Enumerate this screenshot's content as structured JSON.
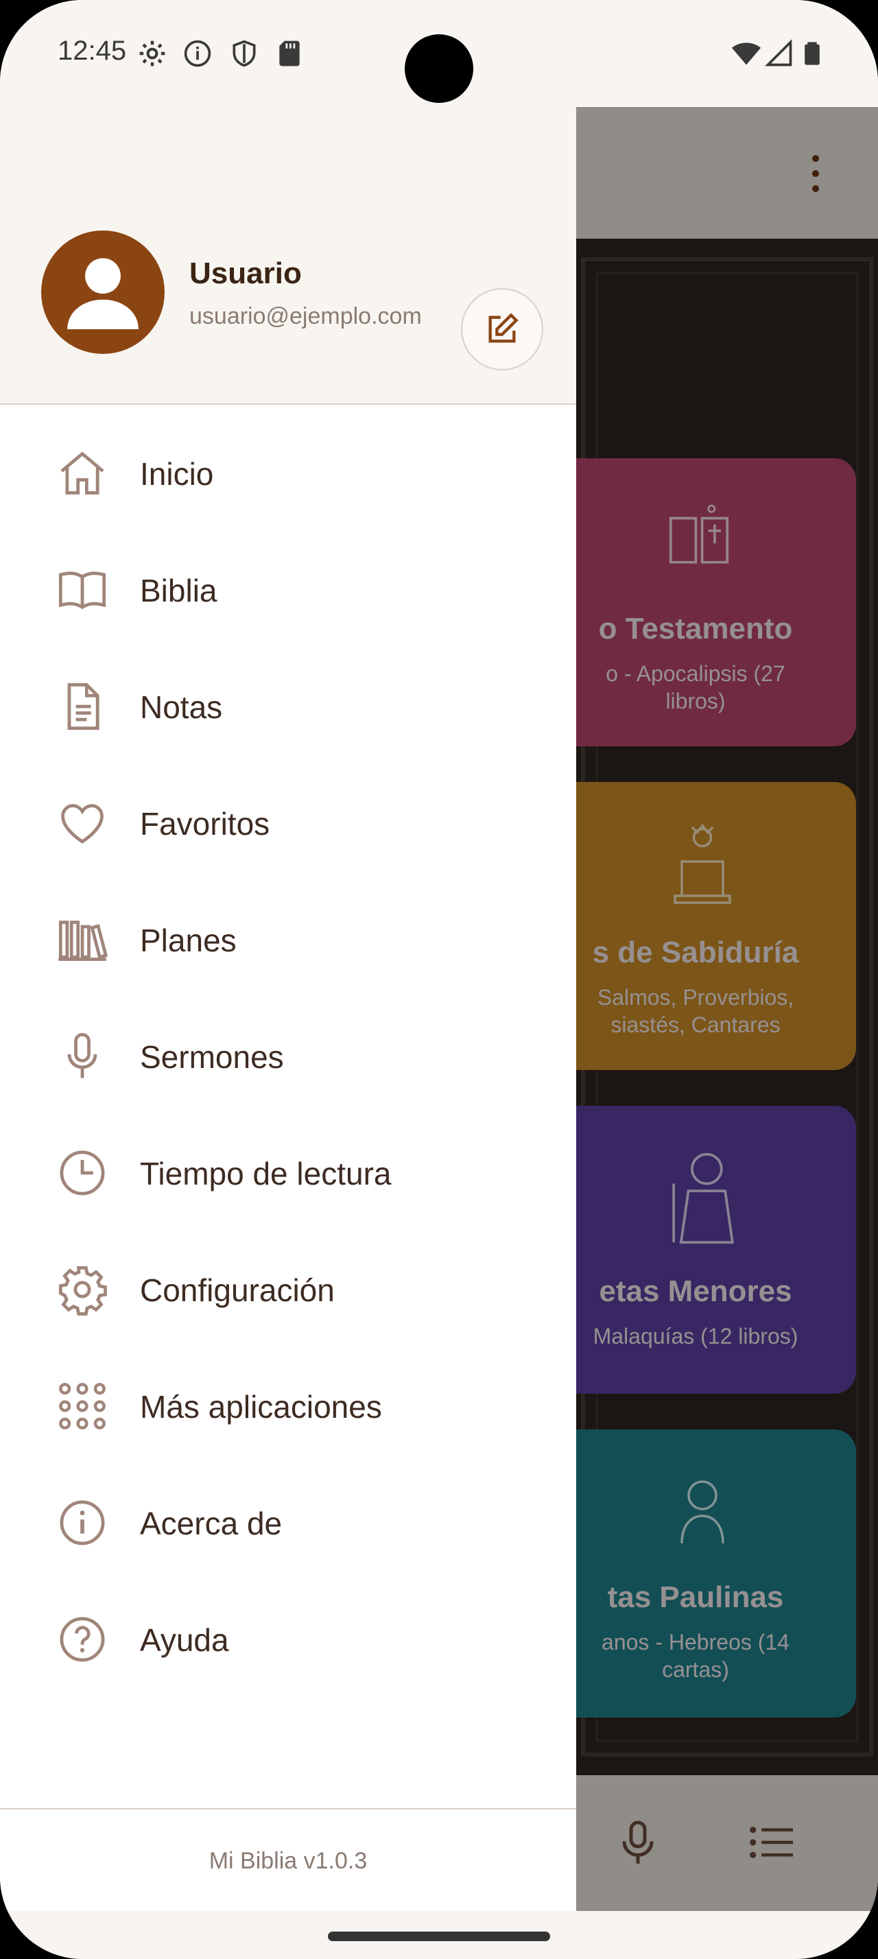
{
  "status_bar": {
    "time": "12:45",
    "left_icons": [
      "settings-icon",
      "info-icon",
      "shield-icon",
      "sd-card-icon"
    ],
    "right_icons": [
      "wifi-icon",
      "signal-icon",
      "battery-icon"
    ]
  },
  "drawer": {
    "user": {
      "name": "Usuario",
      "email": "usuario@ejemplo.com"
    },
    "menu": [
      {
        "label": "Inicio",
        "icon": "home-icon"
      },
      {
        "label": "Biblia",
        "icon": "book-open-icon"
      },
      {
        "label": "Notas",
        "icon": "document-icon"
      },
      {
        "label": "Favoritos",
        "icon": "heart-icon"
      },
      {
        "label": "Planes",
        "icon": "library-icon"
      },
      {
        "label": "Sermones",
        "icon": "microphone-icon"
      },
      {
        "label": "Tiempo de lectura",
        "icon": "clock-icon"
      },
      {
        "label": "Configuración",
        "icon": "gear-icon"
      },
      {
        "label": "Más aplicaciones",
        "icon": "grid-dots-icon"
      },
      {
        "label": "Acerca de",
        "icon": "info-icon"
      },
      {
        "label": "Ayuda",
        "icon": "help-icon"
      }
    ],
    "version": "Mi Biblia v1.0.3"
  },
  "background": {
    "cards": [
      {
        "title": "o Testamento",
        "subtitle": [
          "o - Apocalipsis (27",
          "libros)"
        ],
        "color": "#b5456e"
      },
      {
        "title": "s de Sabiduría",
        "subtitle": [
          "Salmos, Proverbios,",
          "siastés, Cantares"
        ],
        "color": "#c98a28"
      },
      {
        "title": "etas Menores",
        "subtitle": [
          "Malaquías (12 libros)"
        ],
        "color": "#5b3f9e"
      },
      {
        "title": "tas Paulinas",
        "subtitle": [
          "anos - Hebreos (14",
          "cartas)"
        ],
        "color": "#1f7f8a"
      }
    ]
  },
  "colors": {
    "accent": "#8b4513",
    "icon": "#a0857a",
    "text": "#3d2b22"
  }
}
